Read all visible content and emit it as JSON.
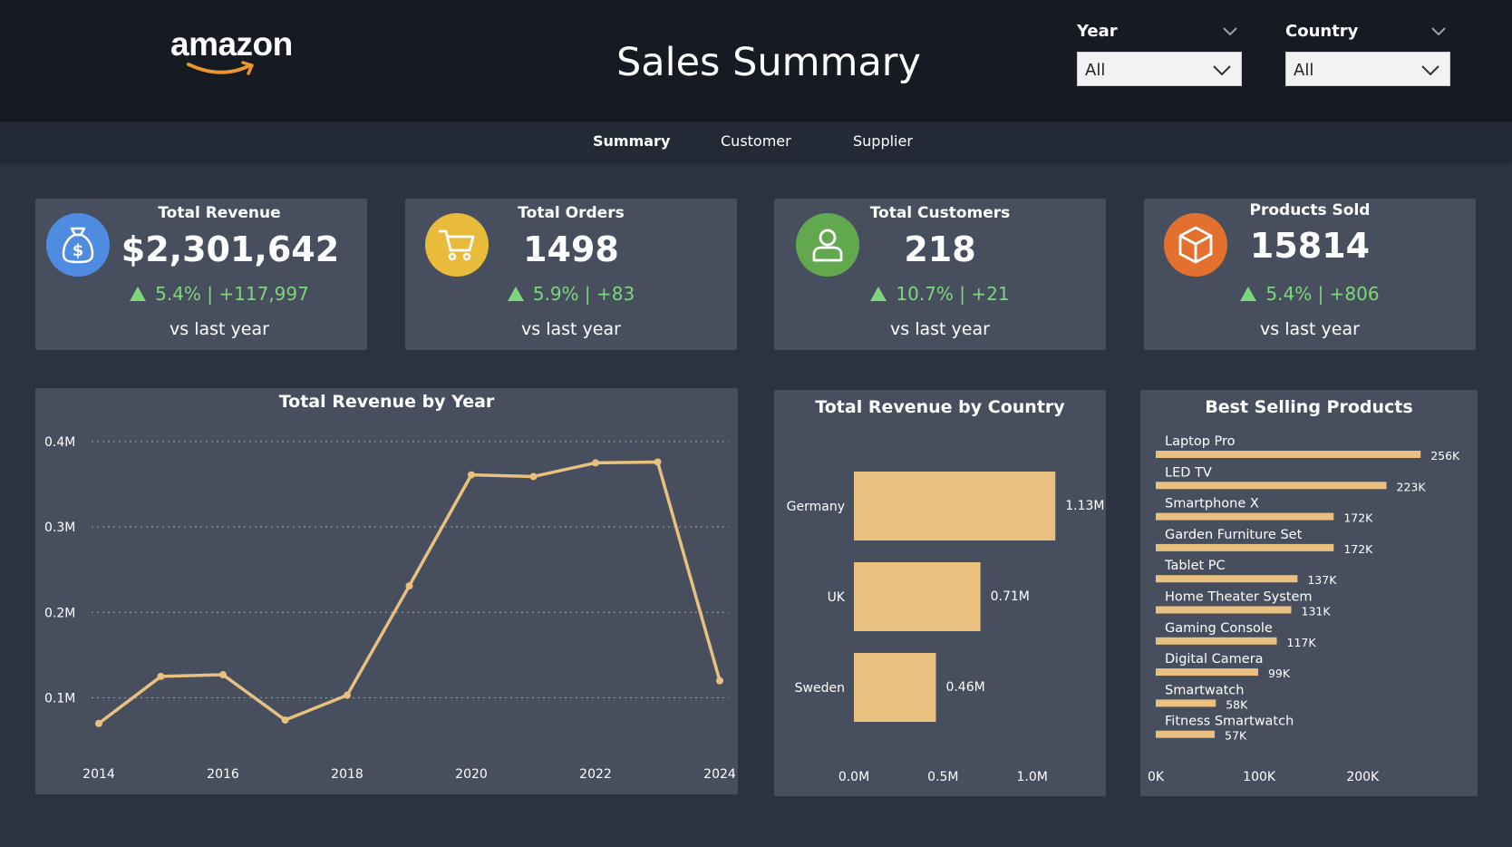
{
  "header": {
    "logo_text": "amazon",
    "title": "Sales Summary",
    "filters": [
      {
        "label": "Year",
        "value": "All"
      },
      {
        "label": "Country",
        "value": "All"
      }
    ]
  },
  "nav": {
    "tabs": [
      {
        "label": "Summary",
        "active": true
      },
      {
        "label": "Customer",
        "active": false
      },
      {
        "label": "Supplier",
        "active": false
      }
    ]
  },
  "kpis": [
    {
      "title": "Total Revenue",
      "value": "$2,301,642",
      "pct": "5.4%",
      "delta": "| +117,997",
      "sub": "vs last year",
      "icon": "money-bag-icon",
      "color": "#4f8be0"
    },
    {
      "title": "Total Orders",
      "value": "1498",
      "pct": "5.9%",
      "delta": "| +83",
      "sub": "vs last year",
      "icon": "shopping-cart-icon",
      "color": "#e9bb3b"
    },
    {
      "title": "Total Customers",
      "value": "218",
      "pct": "10.7%",
      "delta": "| +21",
      "sub": "vs last year",
      "icon": "person-icon",
      "color": "#62a84e"
    },
    {
      "title": "Products Sold",
      "value": "15814",
      "pct": "5.4%",
      "delta": "| +806",
      "sub": "vs last year",
      "icon": "box-icon",
      "color": "#e3702e"
    }
  ],
  "colors": {
    "accent": "#e9c07f",
    "positive": "#7ed67a",
    "card": "#474f5e",
    "background": "#2b3341",
    "header": "#161a23"
  },
  "chart_data": [
    {
      "type": "line",
      "title": "Total Revenue by Year",
      "x": [
        2014,
        2015,
        2016,
        2017,
        2018,
        2019,
        2020,
        2021,
        2022,
        2023,
        2024
      ],
      "x_tick_labels": [
        "2014",
        "2016",
        "2018",
        "2020",
        "2022",
        "2024"
      ],
      "series": [
        {
          "values": [
            70000,
            125000,
            127000,
            74000,
            103000,
            231000,
            361000,
            359000,
            375000,
            376000,
            120000
          ]
        }
      ],
      "y_tick_labels": [
        "0.1M",
        "0.2M",
        "0.3M",
        "0.4M"
      ],
      "y_ticks": [
        100000,
        200000,
        300000,
        400000
      ],
      "ylim": [
        40000,
        420000
      ],
      "grid": true
    },
    {
      "type": "bar",
      "orientation": "horizontal",
      "title": "Total Revenue by Country",
      "categories": [
        "Germany",
        "UK",
        "Sweden"
      ],
      "values": [
        1130000,
        710000,
        460000
      ],
      "value_labels": [
        "1.13M",
        "0.71M",
        "0.46M"
      ],
      "x_tick_labels": [
        "0.0M",
        "0.5M",
        "1.0M"
      ],
      "x_ticks": [
        0,
        500000,
        1000000
      ],
      "xlim": [
        0,
        1200000
      ]
    },
    {
      "type": "bar",
      "orientation": "horizontal",
      "title": "Best Selling Products",
      "categories": [
        "Laptop Pro",
        "LED TV",
        "Smartphone X",
        "Garden Furniture Set",
        "Tablet PC",
        "Home Theater System",
        "Gaming Console",
        "Digital Camera",
        "Smartwatch",
        "Fitness Smartwatch"
      ],
      "values": [
        256000,
        223000,
        172000,
        172000,
        137000,
        131000,
        117000,
        99000,
        58000,
        57000
      ],
      "value_labels": [
        "256K",
        "223K",
        "172K",
        "172K",
        "137K",
        "131K",
        "117K",
        "99K",
        "58K",
        "57K"
      ],
      "x_tick_labels": [
        "0K",
        "100K",
        "200K"
      ],
      "x_ticks": [
        0,
        100000,
        200000
      ],
      "xlim": [
        0,
        290000
      ]
    }
  ]
}
